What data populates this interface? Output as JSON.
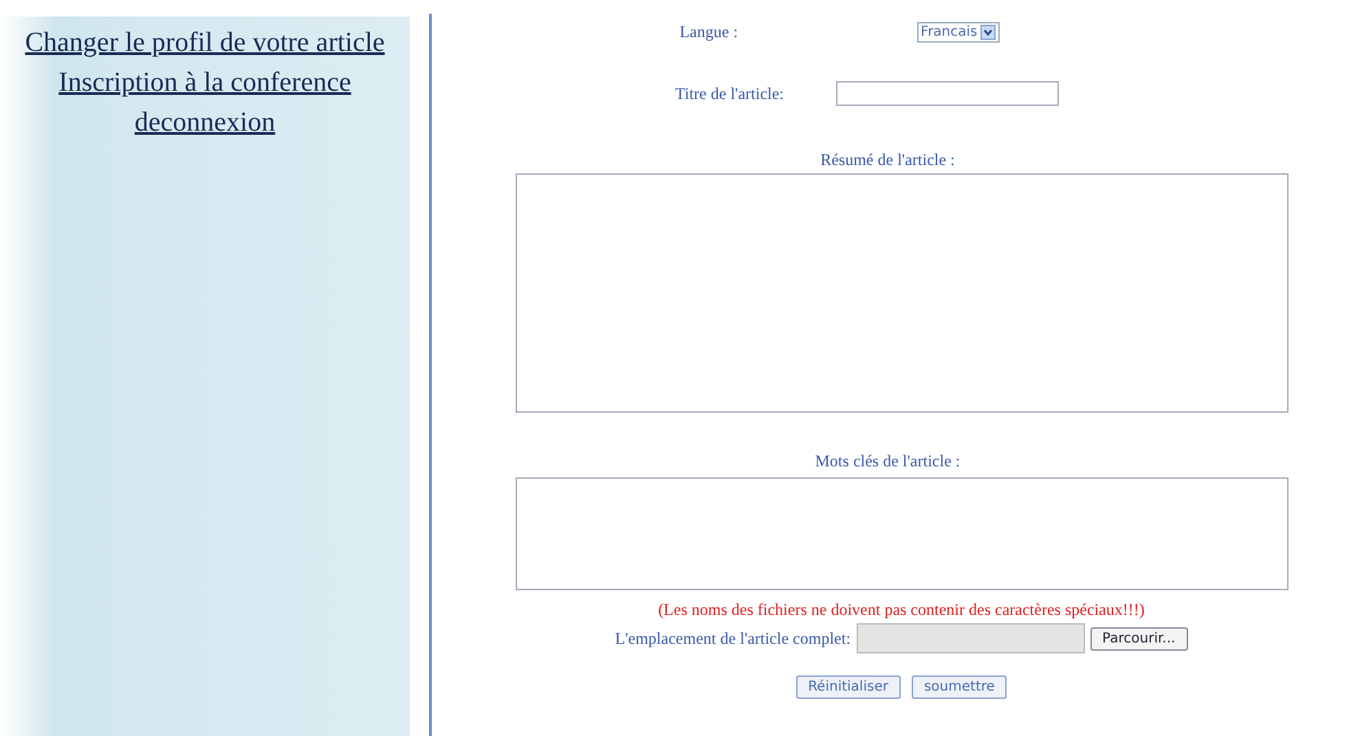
{
  "sidebar": {
    "links": [
      "Changer le profil de votre article",
      "Inscription à la conference",
      "deconnexion"
    ]
  },
  "form": {
    "language": {
      "label": "Langue :",
      "value": "Francais"
    },
    "title": {
      "label": "Titre de l'article:"
    },
    "abstract": {
      "label": "Résumé de l'article :"
    },
    "keywords": {
      "label": "Mots clés de l'article :"
    },
    "warning": "(Les noms des fichiers ne doivent pas contenir des caractères spéciaux!!!)",
    "file": {
      "label": "L'emplacement de l'article complet:",
      "button": "Parcourir..."
    },
    "buttons": [
      "Réinitialiser",
      "soumettre"
    ]
  }
}
